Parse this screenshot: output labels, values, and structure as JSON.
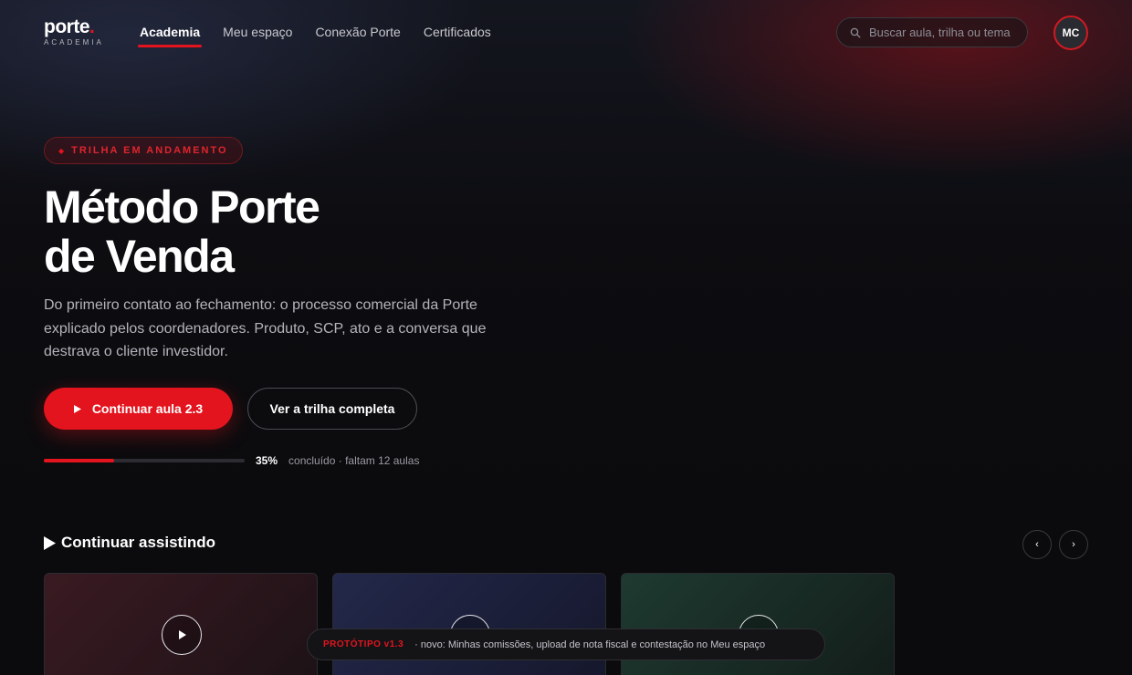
{
  "colors": {
    "accent": "#e3141e",
    "background": "#0b0b0d",
    "text_muted": "#b3b3ba"
  },
  "nav": {
    "logo_word": "porte",
    "logo_dot": ".",
    "logo_sub": "ACADEMIA",
    "links": [
      {
        "label": "Academia",
        "active": true
      },
      {
        "label": "Meu espaço",
        "active": false
      },
      {
        "label": "Conexão Porte",
        "active": false
      },
      {
        "label": "Certificados",
        "active": false
      }
    ],
    "search_placeholder": "Buscar aula, trilha ou tema",
    "avatar_initials": "MC"
  },
  "hero": {
    "badge_icon": "diamond-icon",
    "badge_glyph": "◆",
    "badge": "TRILHA EM ANDAMENTO",
    "title_line1": "Método Porte",
    "title_line2": "de Venda",
    "description": "Do primeiro contato ao fechamento: o processo comercial da Porte explicado pelos coordenadores. Produto, SCP, ato e a conversa que destrava o cliente investidor.",
    "primary_button": "Continuar aula 2.3",
    "secondary_button": "Ver a trilha completa",
    "progress_percent": 35,
    "progress_percent_label": "35%",
    "progress_text": "concluído · faltam 12 aulas"
  },
  "continue_section": {
    "title": "Continuar assistindo",
    "prev_glyph": "‹",
    "next_glyph": "›"
  },
  "toast": {
    "tag": "PROTÓTIPO v1.3",
    "message": "· novo: Minhas comissões, upload de nota fiscal e contestação no Meu espaço"
  }
}
